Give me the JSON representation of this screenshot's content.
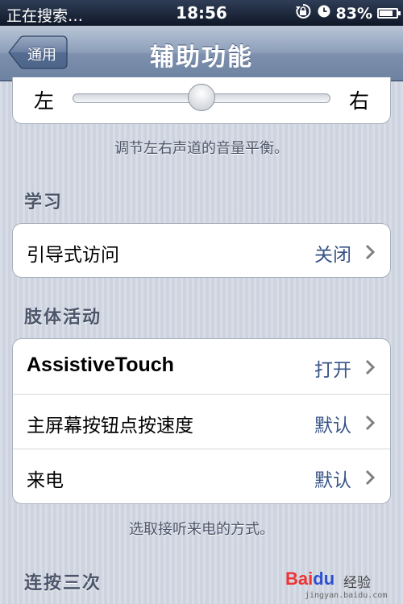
{
  "status_bar": {
    "carrier": "正在搜索…",
    "time": "18:56",
    "battery_percent": "83%",
    "battery_level": 0.83,
    "icons": [
      "rotation-lock-icon",
      "alarm-clock-icon",
      "battery-icon"
    ]
  },
  "nav": {
    "back_label": "通用",
    "title": "辅助功能"
  },
  "balance": {
    "left_label": "左",
    "right_label": "右",
    "value": 0.5,
    "description": "调节左右声道的音量平衡。"
  },
  "learning": {
    "header": "学习",
    "rows": [
      {
        "label": "引导式访问",
        "value": "关闭"
      }
    ]
  },
  "physical": {
    "header": "肢体活动",
    "rows": [
      {
        "label": "AssistiveTouch",
        "value": "打开"
      },
      {
        "label": "主屏幕按钮点按速度",
        "value": "默认"
      },
      {
        "label": "来电",
        "value": "默认"
      }
    ],
    "footer": "选取接听来电的方式。"
  },
  "triple_click": {
    "header": "连按三次"
  },
  "watermark": {
    "logo": "Bai du",
    "jingyan": "经验",
    "url": "jingyan.baidu.com"
  },
  "colors": {
    "value_blue": "#385487",
    "navbar": "#8d9fba",
    "background": "#cdd3df"
  }
}
